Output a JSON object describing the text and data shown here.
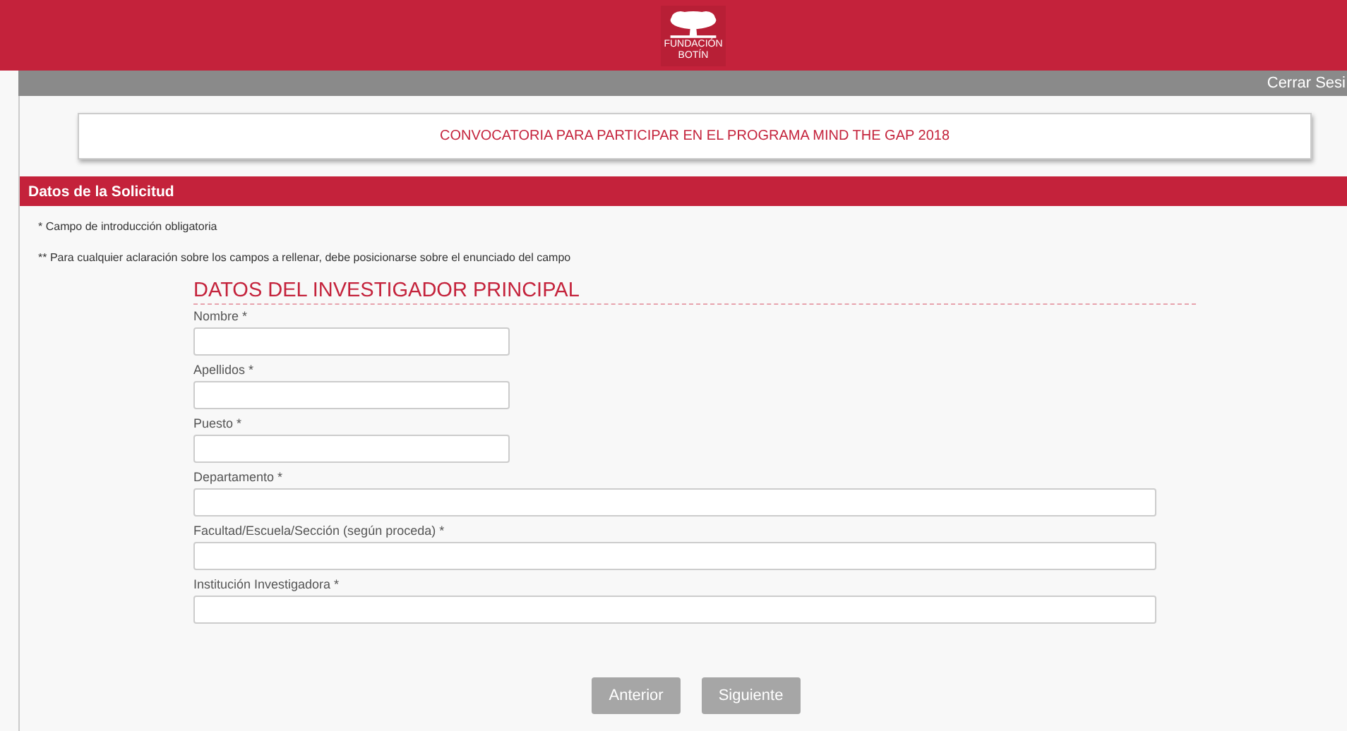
{
  "header": {
    "logo_text": [
      "FUNDACIÓN",
      "BOTÍN"
    ]
  },
  "top_bar": {
    "logout": "Cerrar Sesi"
  },
  "banner": {
    "title": "CONVOCATORIA PARA PARTICIPAR EN EL PROGRAMA MIND THE GAP 2018"
  },
  "section": {
    "title": "Datos de la Solicitud"
  },
  "notes": [
    "* Campo de introducción obligatoria",
    "** Para cualquier aclaración sobre los campos a rellenar, debe posicionarse sobre el enunciado del campo"
  ],
  "form": {
    "heading": "DATOS DEL INVESTIGADOR PRINCIPAL",
    "fields": [
      {
        "label": "Nombre *",
        "kind": "short"
      },
      {
        "label": "Apellidos *",
        "kind": "short"
      },
      {
        "label": "Puesto *",
        "kind": "short"
      },
      {
        "label": "Departamento *",
        "kind": "long"
      },
      {
        "label": "Facultad/Escuela/Sección (según proceda) *",
        "kind": "long"
      },
      {
        "label": "Institución Investigadora *",
        "kind": "long"
      }
    ]
  },
  "buttons": [
    "Anterior",
    "Siguiente"
  ]
}
